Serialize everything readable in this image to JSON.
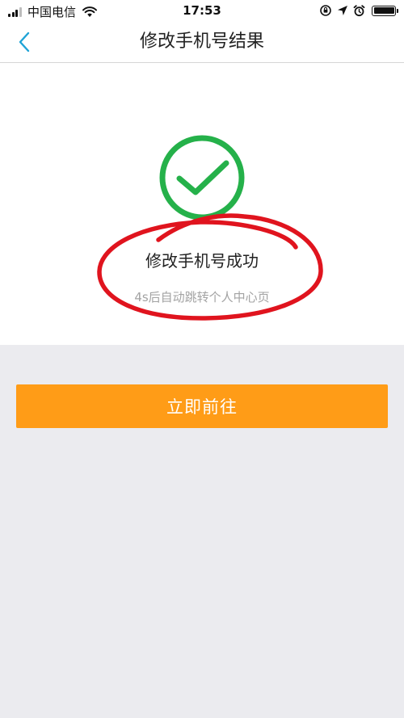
{
  "status_bar": {
    "carrier": "中国电信",
    "time": "17:53"
  },
  "nav": {
    "title": "修改手机号结果"
  },
  "result": {
    "title": "修改手机号成功",
    "countdown": "4s后自动跳转个人中心页"
  },
  "actions": {
    "go_label": "立即前往"
  },
  "colors": {
    "accent_blue": "#1fa3d6",
    "success_green": "#25b14a",
    "button_orange": "#ff9c17",
    "annotation_red": "#e0141e",
    "page_background": "#ebebef"
  }
}
